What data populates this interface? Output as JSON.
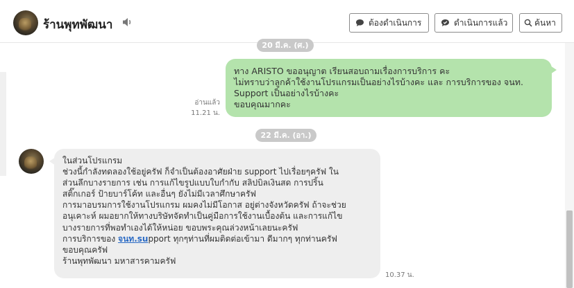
{
  "header": {
    "shop_name": "ร้านพุทพัฒนา",
    "buttons": {
      "todo": "ต้องดำเนินการ",
      "done": "ดำเนินการแล้ว",
      "search": "ค้นหา"
    },
    "icons": [
      "speaker-icon",
      "chat-bubble-icon",
      "chat-check-icon",
      "search-icon"
    ]
  },
  "chat": {
    "date_1": "20 มี.ค. (ศ.)",
    "outgoing": {
      "lines": [
        "ทาง ARISTO ขออนุญาต เรียนสอบถามเรื่องการบริการ คะ",
        "ไม่ทราบว่าลูกค้าใช้งานโปรแกรมเป็นอย่างไรบ้างคะ และ การบริการของ จนท.",
        "Support เป็นอย่างไรบ้างคะ",
        "ขอบคุณมากคะ"
      ],
      "read_label": "อ่านแล้ว",
      "time": "11.21 น."
    },
    "date_2": "22 มี.ค. (อา.)",
    "incoming": {
      "lines": [
        "ในส่วนโปรแกรม",
        "ช่วงนี้กำลังทดลองใช้อยู่ครัฟ ก็จำเป็นต้องอาศัยฝ่าย support ไปเรื่อยๆครัฟ ใน",
        "ส่วนลึกบางรายการ เช่น การแก้ไขรูปแบบใบกำกับ สลิปบิลเงินสด การปริ้น",
        "สติ๊กเกอร์ ป้ายบาร์โค้ท และอื่นๆ ยังไม่มีเวลาศึกษาครัฟ",
        "การมาอบรมการใช้งานโปรแกรม ผมคงไม่มีโอกาส อยู่ต่างจังหวัดครัฟ ถ้าจะช่วย",
        "อนุเคาะห์ ผมอยากให้ทางบริษัทจัดทำเป็นคู่มือการใช้งานเบื้องต้น และการแก้ไข",
        "บางรายการที่พอทำเองได้ให้หน่อย ขอบพระคุณล่วงหน้าเลยนะครัฟ"
      ],
      "service_prefix": "การบริการของ ",
      "service_link": "จนท.su",
      "service_suffix": "pport ทุกๆท่านที่ผมติดต่อเข้ามา ดีมากๆ ทุกท่านครัฟ",
      "closing_lines": [
        "ขอบคุณครัฟ",
        "ร้านพุทพัฒนา มหาสารคามครัฟ"
      ],
      "time": "10.37 น."
    }
  },
  "colors": {
    "outgoing_bubble": "#b4e3ac",
    "incoming_bubble": "#eeeeee",
    "date_pill": "#c9c9c9",
    "link": "#2a6ac4"
  }
}
